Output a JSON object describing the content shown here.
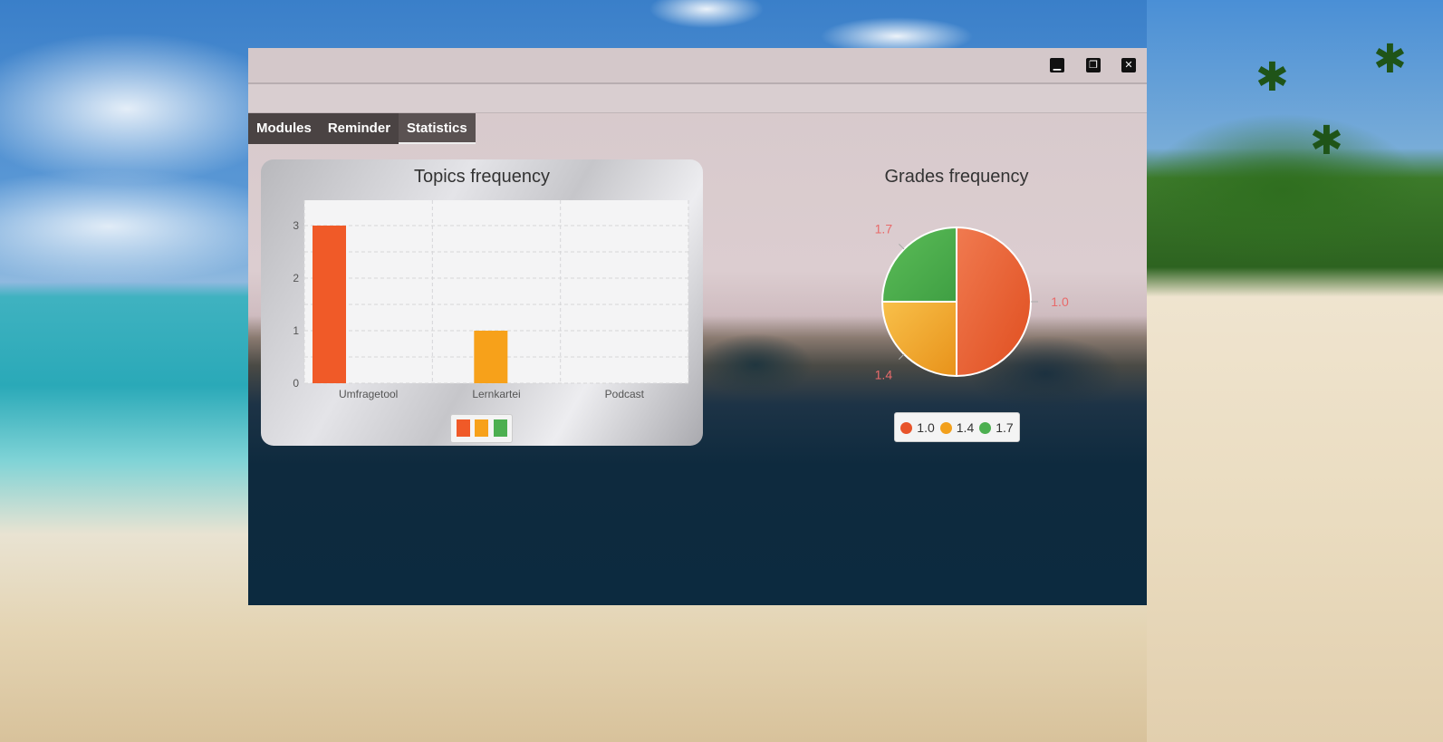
{
  "window": {
    "controls": {
      "minimize_icon": "minimize-icon",
      "restore_icon": "restore-icon",
      "close_icon": "close-icon"
    }
  },
  "tabs": [
    {
      "label": "Modules"
    },
    {
      "label": "Reminder"
    },
    {
      "label": "Statistics",
      "active": true
    }
  ],
  "colors": {
    "orange_red": "#f05a28",
    "orange": "#f7a11a",
    "green": "#4caf50"
  },
  "bar_chart": {
    "title": "Topics frequency",
    "chart_data": {
      "type": "bar",
      "categories": [
        "Umfragetool",
        "Lernkartei",
        "Podcast"
      ],
      "series": [
        {
          "values": [
            3,
            0,
            0
          ]
        },
        {
          "values": [
            0,
            1,
            0
          ]
        },
        {
          "values": [
            0,
            0,
            0
          ]
        }
      ],
      "ylim": [
        0,
        3
      ],
      "yticks": [
        "0",
        "1",
        "2",
        "3"
      ],
      "grid": true
    }
  },
  "pie_chart": {
    "title": "Grades frequency",
    "chart_data": {
      "type": "pie",
      "labels": [
        "1.0",
        "1.4",
        "1.7"
      ],
      "values": [
        2,
        1,
        1
      ]
    },
    "legend": [
      {
        "label": "1.0"
      },
      {
        "label": "1.4"
      },
      {
        "label": "1.7"
      }
    ]
  }
}
